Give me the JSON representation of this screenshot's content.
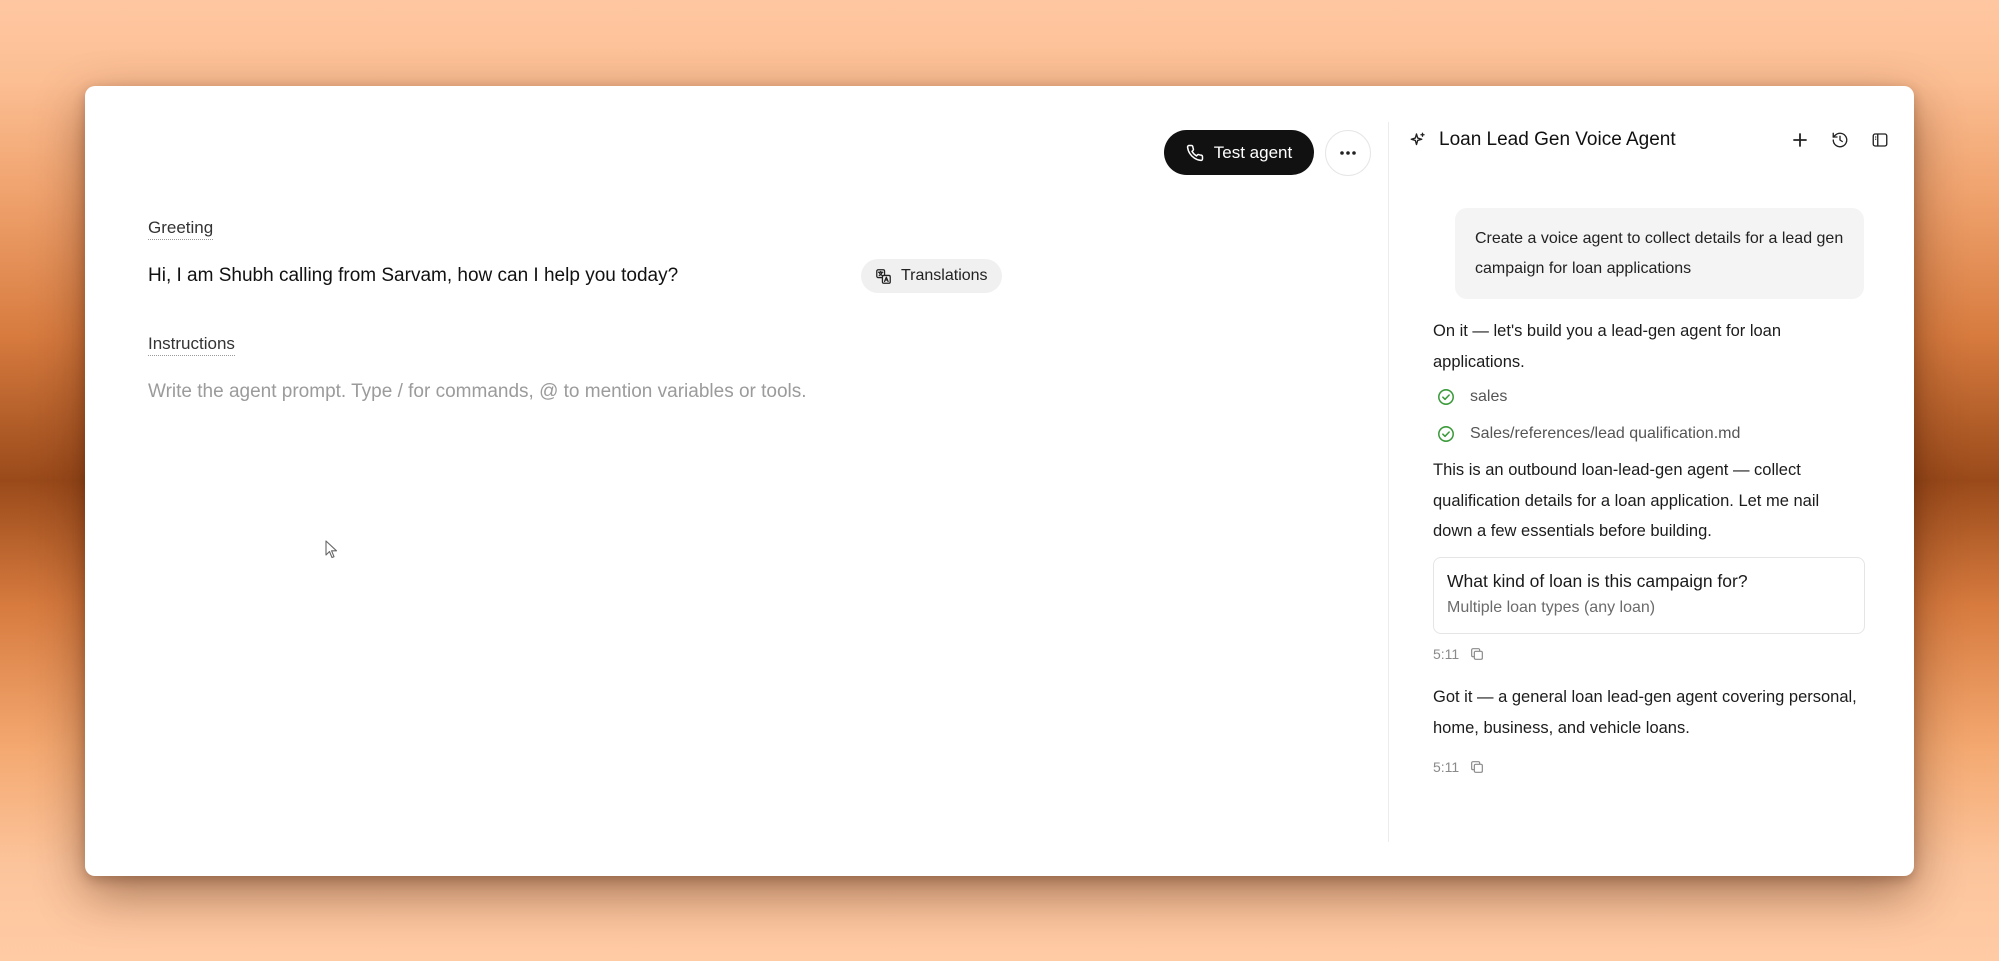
{
  "toolbar": {
    "test_agent_label": "Test agent"
  },
  "greeting": {
    "label": "Greeting",
    "text": "Hi, I am Shubh calling from Sarvam, how can I help you today?",
    "translations_label": "Translations"
  },
  "instructions": {
    "label": "Instructions",
    "placeholder": "Write the agent prompt. Type / for commands, @ to mention variables or tools."
  },
  "panel": {
    "title": "Loan Lead Gen Voice Agent"
  },
  "chat": {
    "user_message": "Create a voice agent to collect details for a lead gen campaign for loan applications",
    "assistant_intro": "On it — let's build you a lead-gen agent for loan applications.",
    "steps": [
      "sales",
      "Sales/references/lead qualification.md"
    ],
    "assistant_body": "This is an outbound loan-lead-gen agent — collect qualification details for a loan application. Let me nail down a few essentials before building.",
    "question": {
      "text": "What kind of loan is this campaign for?",
      "answer": "Multiple loan types (any loan)"
    },
    "timestamp_1": "5:11",
    "assistant_followup": "Got it — a general loan lead-gen agent covering personal, home, business, and vehicle loans.",
    "timestamp_2": "5:11"
  },
  "colors": {
    "check_green": "#3a9a3a",
    "button_dark": "#111111"
  }
}
